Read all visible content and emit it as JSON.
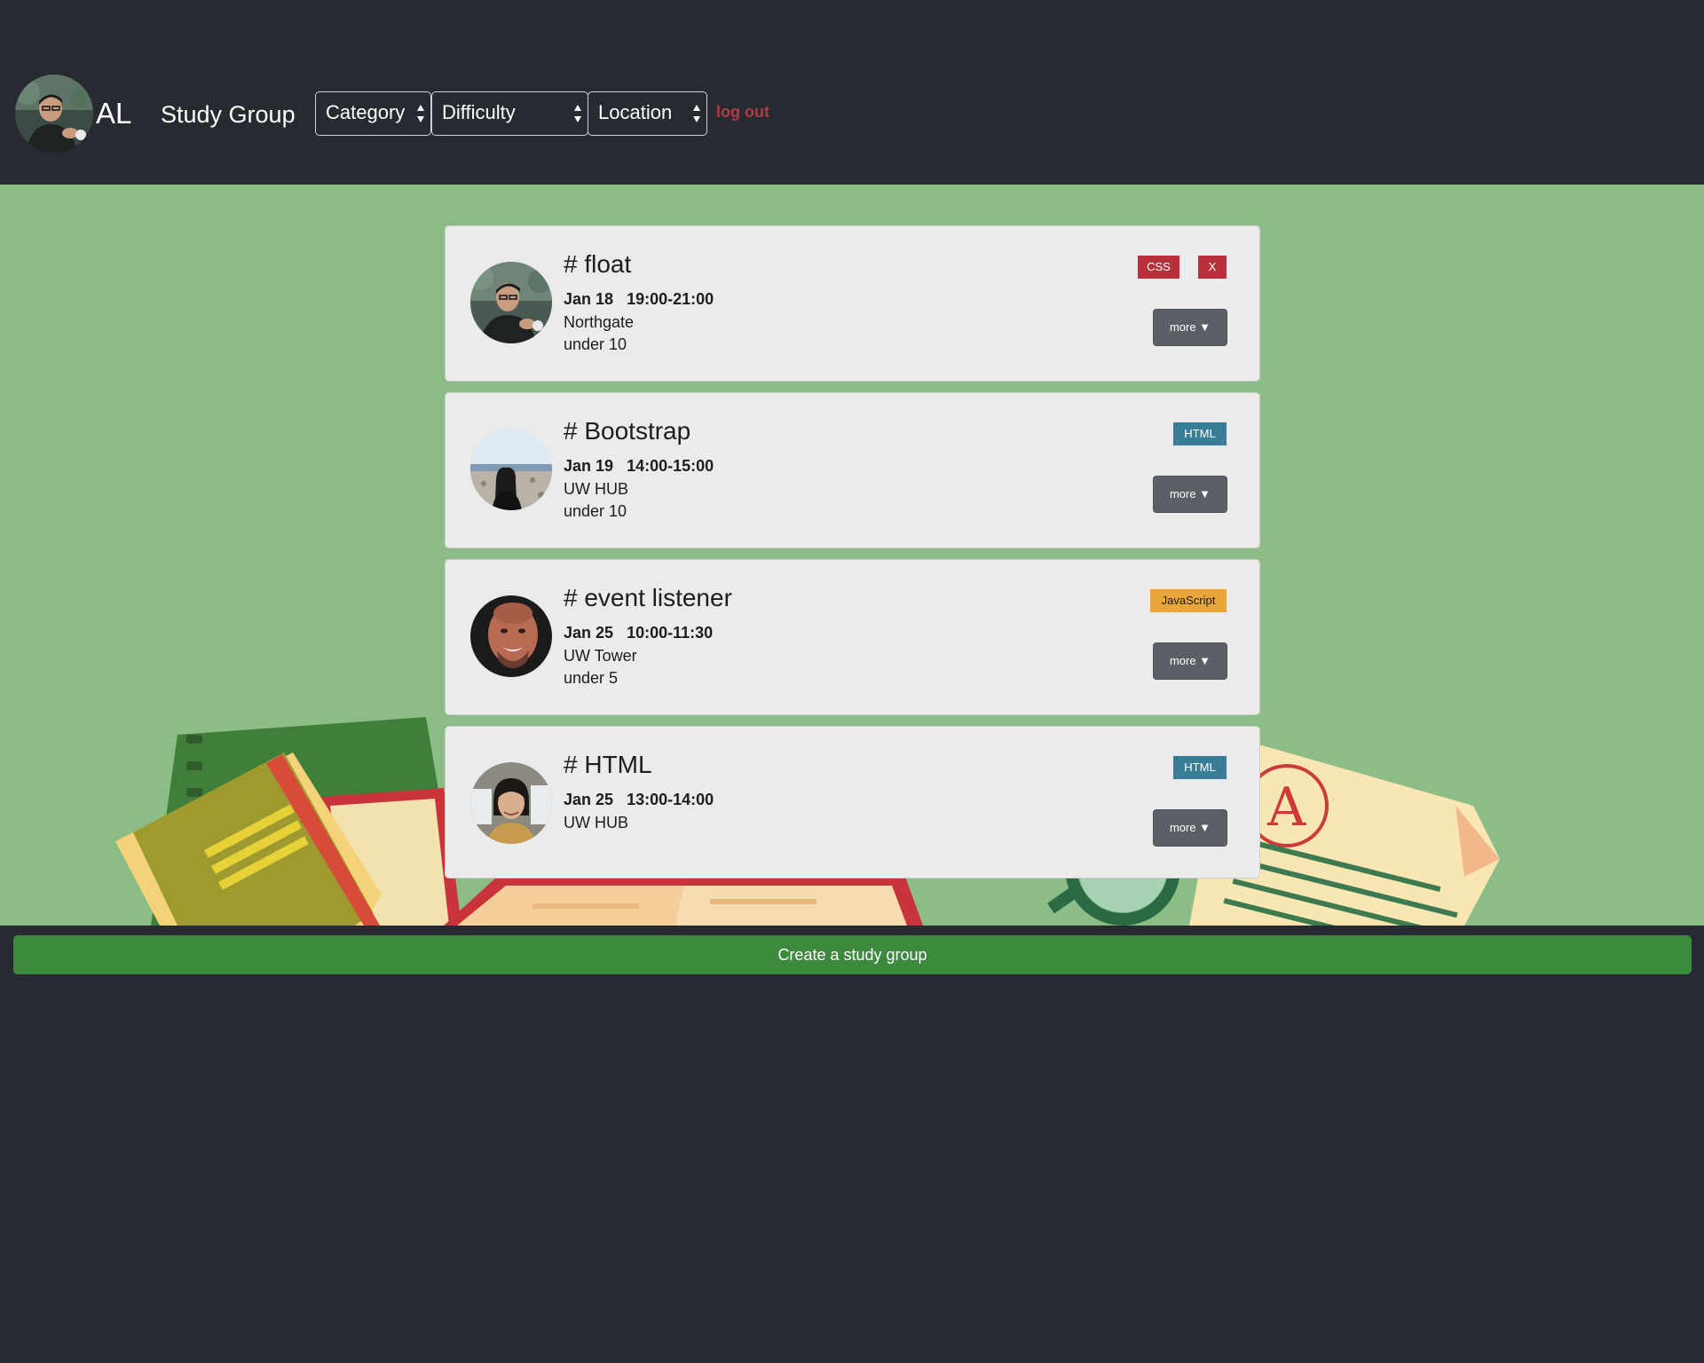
{
  "header": {
    "user_initials": "AL",
    "app_title": "Study Group",
    "filters": {
      "category": "Category",
      "difficulty": "Difficulty",
      "location": "Location"
    },
    "logout_label": "log out"
  },
  "groups": [
    {
      "title": "# float",
      "date": "Jan 18",
      "time": "19:00-21:00",
      "location": "Northgate",
      "size": "under 10",
      "tag": "CSS",
      "delete_label": "X",
      "more_label": "more ▼",
      "avatar": "man-with-glasses-avatar"
    },
    {
      "title": "# Bootstrap",
      "date": "Jan 19",
      "time": "14:00-15:00",
      "location": "UW HUB",
      "size": "under 10",
      "tag": "HTML",
      "more_label": "more ▼",
      "avatar": "woman-at-beach-avatar"
    },
    {
      "title": "# event listener",
      "date": "Jan 25",
      "time": "10:00-11:30",
      "location": "UW Tower",
      "size": "under 5",
      "tag": "JavaScript",
      "more_label": "more ▼",
      "avatar": "smiling-man-avatar"
    },
    {
      "title": "# HTML",
      "date": "Jan 25",
      "time": "13:00-14:00",
      "location": "UW HUB",
      "tag": "HTML",
      "more_label": "more ▼",
      "avatar": "woman-portrait-avatar"
    }
  ],
  "create_button_label": "Create a study group",
  "colors": {
    "header_bg": "#272a31",
    "main_bg": "#8dbd87",
    "card_bg": "#ebebeb",
    "css_tag": "#b7303b",
    "html_tag": "#3a7d96",
    "js_tag": "#e7a53a",
    "logout": "#b53a46",
    "create_button": "#3d893d"
  }
}
